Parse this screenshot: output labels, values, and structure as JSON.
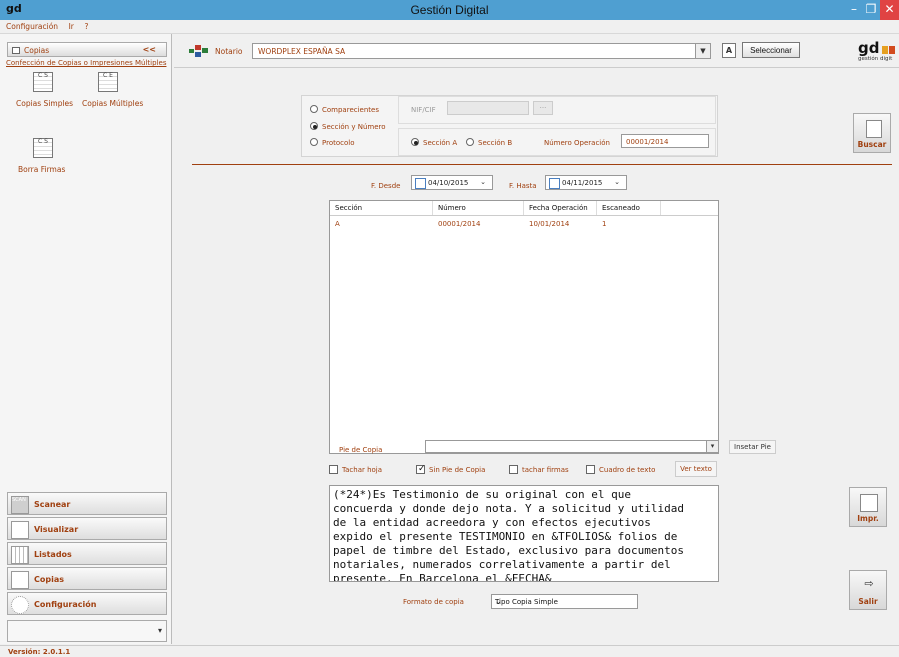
{
  "window": {
    "logo": "gd",
    "title": "Gestión Digital",
    "minimize": "–",
    "maximize": "❐",
    "close": "✕"
  },
  "menu": [
    "Configuración",
    "Ir",
    "?"
  ],
  "left": {
    "panel_title": "Copias",
    "collapse": "<<",
    "section_link": "Confección de Copias o Impresiones Múltiples",
    "items": [
      {
        "label": "Copias Simples",
        "icon_text": "C S"
      },
      {
        "label": "Copias Múltiples",
        "icon_text": "C E"
      },
      {
        "label": "Borra Firmas",
        "icon_text": "C S"
      }
    ],
    "nav": [
      "Scanear",
      "Visualizar",
      "Listados",
      "Copias",
      "Configuración"
    ],
    "nav_scan_overlay": "SCAN",
    "nav_more": "▾"
  },
  "topbar": {
    "notario_label": "Notario",
    "notario_value": "WORDPLEX ESPAÑA SA",
    "a_button": "A",
    "select_button": "Seleccionar",
    "logo_text": "gd",
    "logo_sub": "gestión digit"
  },
  "filters": {
    "radios": [
      "Comparecientes",
      "Sección y Número",
      "Protocolo"
    ],
    "selected_radio": 1,
    "nif_label": "NIF/CIF",
    "nif_value": "",
    "ellipsis": "...",
    "section_a": "Sección A",
    "section_b": "Sección B",
    "num_op_label": "Número Operación",
    "num_op_value": "00001/2014",
    "buscar": "Buscar"
  },
  "dates": {
    "desde_label": "F. Desde",
    "desde_value": "04/10/2015",
    "hasta_label": "F. Hasta",
    "hasta_value": "04/11/2015"
  },
  "table": {
    "headers": [
      "Sección",
      "Número",
      "Fecha Operación",
      "Escaneado"
    ],
    "rows": [
      [
        "A",
        "00001/2014",
        "10/01/2014",
        "1"
      ]
    ]
  },
  "bottom": {
    "pie_label": "Pie de Copia",
    "pie_value": "",
    "insertar": "Insetar Pie",
    "checks": [
      {
        "label": "Tachar hoja",
        "checked": false
      },
      {
        "label": "Sin Pie de Copia",
        "checked": true
      },
      {
        "label": "tachar firmas",
        "checked": false
      },
      {
        "label": "Cuadro de texto",
        "checked": false
      }
    ],
    "ver_texto": "Ver texto",
    "text": "(*24*)Es Testimonio de su original con el que\nconcuerda y donde dejo nota. Y a solicitud y utilidad\nde la entidad acreedora y con efectos ejecutivos\nexpido el presente TESTIMONIO en &TFOLIOS& folios de\npapel de timbre del Estado, exclusivo para documentos\nnotariales, numerados correlativamente a partir del\npresente. En Barcelona el &FECHA&",
    "formato_label": "Formato de copia",
    "formato_value": "Tipo Copia Simple",
    "impr": "Impr.",
    "salir": "Salir"
  },
  "status": "Versión: 2.0.1.1",
  "colors": {
    "titlebar": "#4f9fd1",
    "accent": "#a04010",
    "close": "#e04343"
  }
}
